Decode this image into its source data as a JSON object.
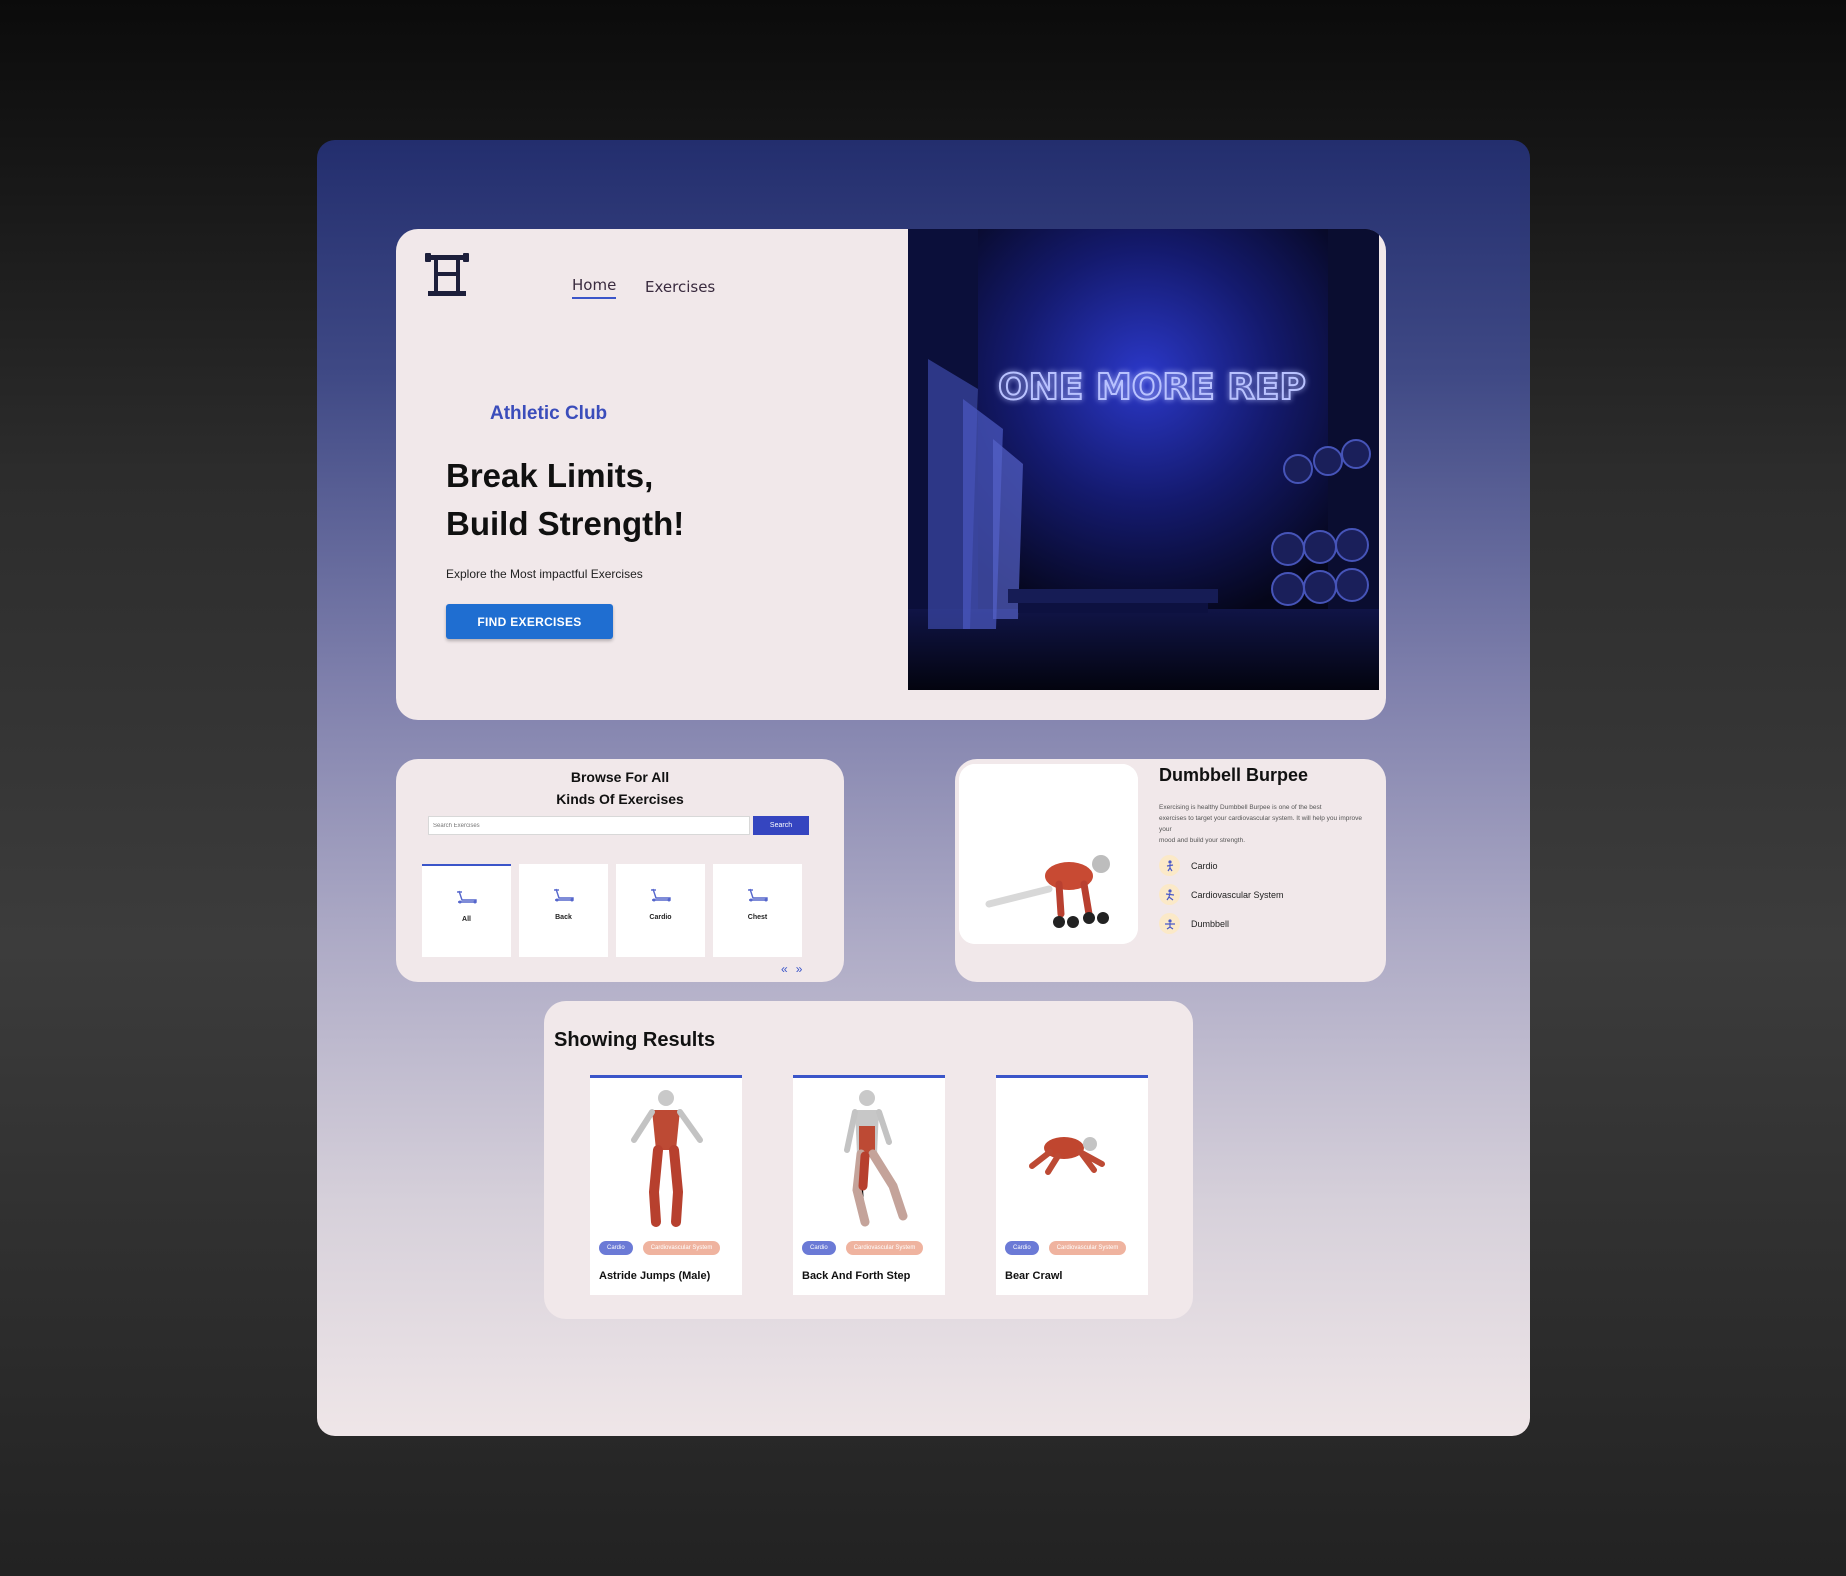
{
  "nav": {
    "logo_icon": "barbell-rack-icon",
    "items": [
      {
        "label": "Home",
        "active": true
      },
      {
        "label": "Exercises",
        "active": false
      }
    ]
  },
  "hero": {
    "eyebrow": "Athletic Club",
    "headline_line1": "Break Limits,",
    "headline_line2": "Build Strength!",
    "subtitle": "Explore the Most impactful Exercises",
    "cta_label": "FIND EXERCISES",
    "photo_neon_text": "ONE MORE REP"
  },
  "browse": {
    "title_line1": "Browse For All",
    "title_line2": "Kinds Of Exercises",
    "search_placeholder": "Search Exercises",
    "search_button": "Search",
    "categories": [
      {
        "label": "All",
        "active": true
      },
      {
        "label": "Back",
        "active": false
      },
      {
        "label": "Cardio",
        "active": false
      },
      {
        "label": "Chest",
        "active": false
      }
    ],
    "prev_icon": "double-chevron-left-icon",
    "next_icon": "double-chevron-right-icon"
  },
  "detail": {
    "title": "Dumbbell Burpee",
    "description": [
      "Exercising is healthy Dumbbell Burpee is one of the best",
      "exercises to target your cardiovascular system. It will help you improve",
      "your",
      "mood and build your strength."
    ],
    "tags": [
      {
        "label": "Cardio",
        "icon": "body-part-icon"
      },
      {
        "label": "Cardiovascular System",
        "icon": "target-muscle-icon"
      },
      {
        "label": "Dumbbell",
        "icon": "equipment-icon"
      }
    ]
  },
  "results": {
    "title": "Showing Results",
    "items": [
      {
        "name": "Astride Jumps (Male)",
        "tag1": "Cardio",
        "tag2": "Cardiovascular System"
      },
      {
        "name": "Back And Forth Step",
        "tag1": "Cardio",
        "tag2": "Cardiovascular System"
      },
      {
        "name": "Bear Crawl",
        "tag1": "Cardio",
        "tag2": "Cardiovascular System"
      }
    ]
  },
  "colors": {
    "accent": "#3b55c9",
    "cta": "#1f6ed1",
    "pill_primary": "#6b7ad6",
    "pill_secondary": "#efb39f",
    "card_bg": "#f1e8ea"
  }
}
